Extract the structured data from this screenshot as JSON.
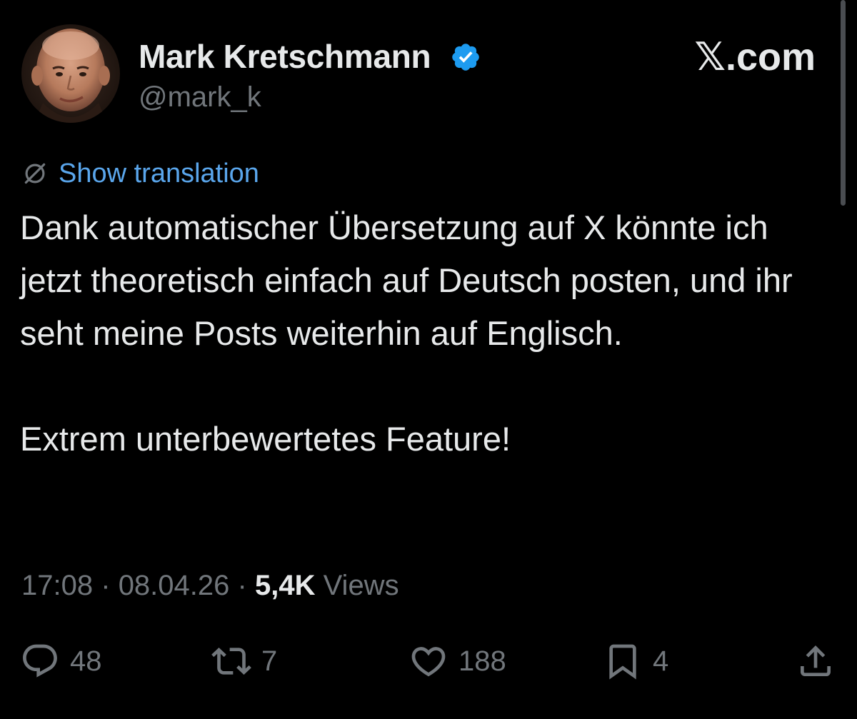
{
  "author": {
    "name": "Mark Kretschmann",
    "handle": "@mark_k",
    "verified": true,
    "avatar_icon": "avatar-photo"
  },
  "brand": "𝕏.com",
  "translation": {
    "icon": "translate-icon",
    "label": "Show translation"
  },
  "post": {
    "paragraph_1": "Dank automatischer Übersetzung auf X könnte ich jetzt theoretisch einfach auf Deutsch posten, und ihr seht meine Posts weiterhin auf Englisch.",
    "paragraph_2": "Extrem unterbewertetes Feature!"
  },
  "meta": {
    "time": "17:08",
    "separator": "·",
    "date": "08.04.26",
    "views_count": "5,4K",
    "views_label": "Views"
  },
  "actions": {
    "replies": {
      "icon": "reply-icon",
      "count": "48"
    },
    "reposts": {
      "icon": "repost-icon",
      "count": "7"
    },
    "likes": {
      "icon": "heart-icon",
      "count": "188"
    },
    "bookmarks": {
      "icon": "bookmark-icon",
      "count": "4"
    },
    "share": {
      "icon": "share-icon"
    }
  },
  "colors": {
    "background": "#000000",
    "primary_text": "#e7e9ea",
    "secondary_text": "#71767b",
    "link": "#5aa6ec",
    "verified_badge": "#1d9bf0"
  }
}
